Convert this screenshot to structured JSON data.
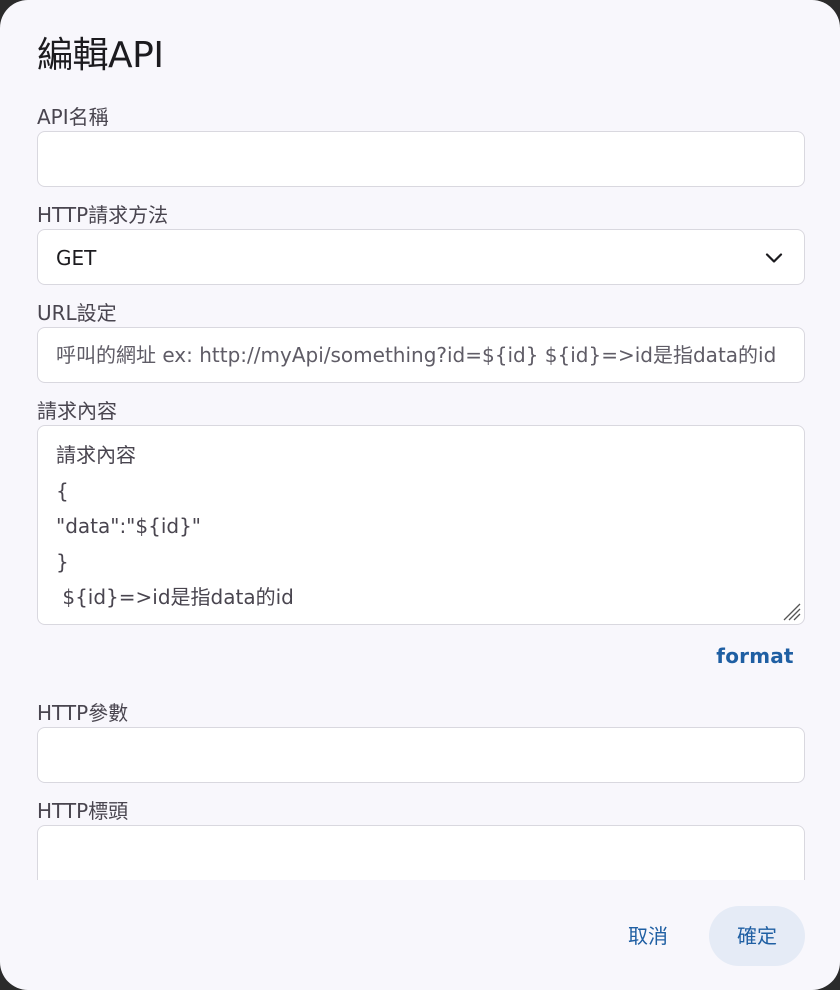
{
  "dialog": {
    "title": "編輯API"
  },
  "fields": {
    "api_name": {
      "label": "API名稱",
      "value": "",
      "placeholder": ""
    },
    "http_method": {
      "label": "HTTP請求方法",
      "value": "GET",
      "icon": "chevron-down-icon"
    },
    "url": {
      "label": "URL設定",
      "value": "",
      "placeholder": "呼叫的網址 ex: http://myApi/something?id=${id} ${id}=>id是指data的id"
    },
    "request_body": {
      "label": "請求內容",
      "value": "",
      "placeholder": "請求內容\n{\n\"data\":\"${id}\"\n}\n ${id}=>id是指data的id"
    },
    "http_params": {
      "label": "HTTP參數",
      "value": "",
      "placeholder": ""
    },
    "http_headers": {
      "label": "HTTP標頭",
      "value": "",
      "placeholder": ""
    }
  },
  "actions": {
    "format_label": "format",
    "cancel_label": "取消",
    "confirm_label": "確定"
  },
  "colors": {
    "accent": "#1f5fa3",
    "confirm_bg": "#e5ebf6",
    "dialog_bg": "#f8f7fc"
  }
}
